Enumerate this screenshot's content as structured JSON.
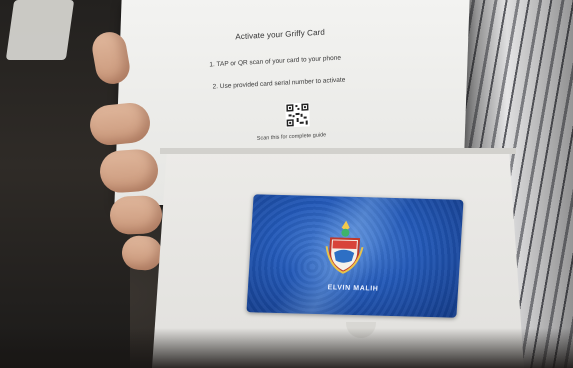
{
  "photo": {
    "subject": "hand holding an opened gift card box",
    "colors": {
      "box": "#ecebe8",
      "card": "#2359b8",
      "skin": "#d7a88b",
      "shirt_stripe": "#5f6066"
    }
  },
  "box_lid": {
    "title": "Activate your Griffy Card",
    "steps": [
      {
        "text": "1.  TAP or QR scan of your card to your phone"
      },
      {
        "text": "2.  Use provided card serial number to activate"
      }
    ],
    "qr_icon": "qr-code-icon",
    "scan_caption": "Scan this for complete guide"
  },
  "card": {
    "name": "ELVIN MALIH",
    "emblem": "crest-icon"
  }
}
